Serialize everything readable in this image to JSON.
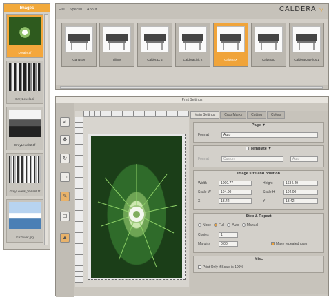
{
  "images_panel": {
    "title": "Images",
    "items": [
      {
        "caption": "Details.tif",
        "pic": "flower",
        "selected": true
      },
      {
        "caption": "GreyLevels.tif",
        "pic": "bw1",
        "selected": false
      },
      {
        "caption": "GreyLevels2.tif",
        "pic": "bw2",
        "selected": false
      },
      {
        "caption": "GreyLevels_Variant.tif",
        "pic": "bw3",
        "selected": false
      },
      {
        "caption": "IceTower.jpg",
        "pic": "mtn",
        "selected": false
      }
    ]
  },
  "top_window": {
    "menu": [
      "File",
      "Special",
      "About"
    ],
    "logo": "CALDERA",
    "printers": [
      {
        "label": "Gangster",
        "selected": false
      },
      {
        "label": "Tilings",
        "selected": false
      },
      {
        "label": "CalderaX 2",
        "selected": false
      },
      {
        "label": "CalderaLink 2",
        "selected": false
      },
      {
        "label": "CalderaX",
        "selected": true
      },
      {
        "label": "CalderaC",
        "selected": false
      },
      {
        "label": "CalderaCut Plus 1",
        "selected": false
      }
    ]
  },
  "main_window": {
    "title": "Print Settings",
    "tools": [
      "pointer-icon",
      "move-icon",
      "rotate-icon",
      "page-icon",
      "crop-icon",
      "fit-icon",
      "lock-icon"
    ],
    "tabs": [
      "Main Settings",
      "Crop Marks",
      "Cutting",
      "Colors"
    ],
    "page": {
      "title": "Page",
      "format_label": "Format",
      "format_value": "Auto"
    },
    "template": {
      "title": "Template",
      "format_label": "Format",
      "format_value": "Custom",
      "extra_value": "Auto"
    },
    "image_size": {
      "title": "Image size and position",
      "width_label": "Width",
      "width_value": "1000.77",
      "height_label": "Height",
      "height_value": "1634.49",
      "scalew_label": "Scale W",
      "scalew_value": "104.00",
      "scaleh_label": "Scale H",
      "scaleh_value": "104.00",
      "x_label": "X",
      "x_value": "13.42",
      "y_label": "Y",
      "y_value": "13.42"
    },
    "step_repeat": {
      "title": "Step & Repeat",
      "options": [
        "None",
        "Full",
        "Auto",
        "Manual"
      ],
      "selected": "Full",
      "copies_label": "Copies",
      "copies_value": "1",
      "margins_label": "Margins",
      "margins_value": "0.00",
      "make_repeated_label": "Make repeated rows"
    },
    "misc": {
      "title": "Misc",
      "print_only_label": "Print Only if Scale is 100%"
    }
  }
}
